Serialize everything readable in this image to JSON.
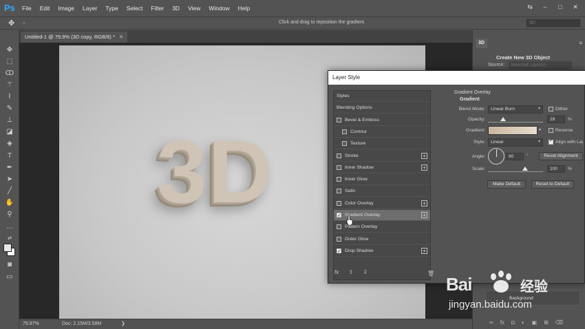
{
  "app": {
    "logo": "Ps",
    "menu": [
      "File",
      "Edit",
      "Image",
      "Layer",
      "Type",
      "Select",
      "Filter",
      "3D",
      "View",
      "Window",
      "Help"
    ],
    "window_controls": [
      "⇆",
      "–",
      "□",
      "✕"
    ]
  },
  "options_bar": {
    "hint": "Click and drag to reposition the gradient.",
    "mode_value": "3D"
  },
  "document": {
    "tab_title": "Untitled-1 @ 79.9% (3D copy, RGB/8) *",
    "canvas_text": "3D"
  },
  "status": {
    "zoom": "79.87%",
    "doc_size": "Doc: 2.15M/3.58M",
    "arrow": "❯"
  },
  "right_panel": {
    "tab": "3D",
    "create_title": "Create New 3D Object",
    "source_label": "Source:",
    "source_value": "Selected Layer(s)",
    "layer_name": "Background"
  },
  "dialog": {
    "title": "Layer Style",
    "styles": [
      {
        "label": "Styles",
        "checkbox": false,
        "checked": false,
        "plus": false,
        "indent": 0,
        "selected": false
      },
      {
        "label": "Blending Options",
        "checkbox": false,
        "checked": false,
        "plus": false,
        "indent": 0,
        "selected": false
      },
      {
        "label": "Bevel & Emboss",
        "checkbox": true,
        "checked": false,
        "plus": false,
        "indent": 0,
        "selected": false
      },
      {
        "label": "Contour",
        "checkbox": true,
        "checked": false,
        "plus": false,
        "indent": 1,
        "selected": false
      },
      {
        "label": "Texture",
        "checkbox": true,
        "checked": false,
        "plus": false,
        "indent": 1,
        "selected": false
      },
      {
        "label": "Stroke",
        "checkbox": true,
        "checked": false,
        "plus": true,
        "indent": 0,
        "selected": false
      },
      {
        "label": "Inner Shadow",
        "checkbox": true,
        "checked": false,
        "plus": true,
        "indent": 0,
        "selected": false
      },
      {
        "label": "Inner Glow",
        "checkbox": true,
        "checked": false,
        "plus": false,
        "indent": 0,
        "selected": false
      },
      {
        "label": "Satin",
        "checkbox": true,
        "checked": false,
        "plus": false,
        "indent": 0,
        "selected": false
      },
      {
        "label": "Color Overlay",
        "checkbox": true,
        "checked": false,
        "plus": true,
        "indent": 0,
        "selected": false
      },
      {
        "label": "Gradient Overlay",
        "checkbox": true,
        "checked": true,
        "plus": true,
        "indent": 0,
        "selected": true
      },
      {
        "label": "Pattern Overlay",
        "checkbox": true,
        "checked": false,
        "plus": false,
        "indent": 0,
        "selected": false
      },
      {
        "label": "Outer Glow",
        "checkbox": true,
        "checked": false,
        "plus": false,
        "indent": 0,
        "selected": false
      },
      {
        "label": "Drop Shadow",
        "checkbox": true,
        "checked": true,
        "plus": true,
        "indent": 0,
        "selected": false
      }
    ],
    "fx_label": "fx",
    "section_title": "Gradient Overlay",
    "section_subtitle": "Gradient",
    "blend_mode_label": "Blend Mode:",
    "blend_mode_value": "Linear Burn",
    "dither_label": "Dither",
    "dither_checked": false,
    "opacity_label": "Opacity:",
    "opacity_value": "28",
    "opacity_fraction": 0.28,
    "percent": "%",
    "gradient_label": "Gradient:",
    "reverse_label": "Reverse",
    "reverse_checked": false,
    "style_label": "Style:",
    "style_value": "Linear",
    "align_label": "Align with Layer",
    "align_checked": true,
    "angle_label": "Angle:",
    "angle_value": "90",
    "degree": "°",
    "reset_alignment": "Reset Alignment",
    "scale_label": "Scale:",
    "scale_value": "100",
    "scale_fraction": 0.67,
    "make_default": "Make Default",
    "reset_default": "Reset to Default"
  },
  "watermark": {
    "logo": "Bai",
    "jy": "经验",
    "url": "jingyan.baidu.com"
  }
}
